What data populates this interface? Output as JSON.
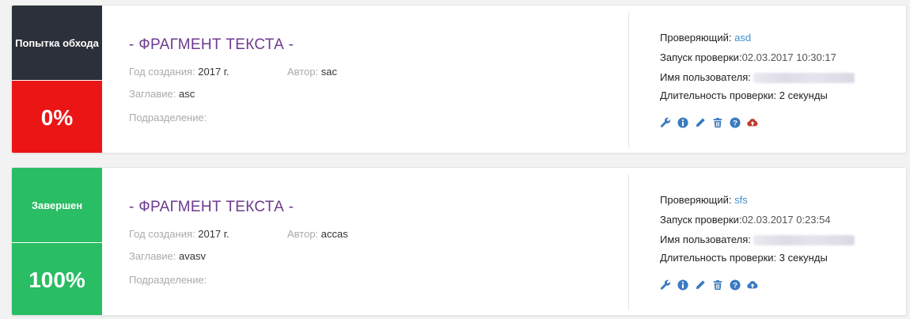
{
  "colors": {
    "dark": "#2b303a",
    "red": "#ec1515",
    "green": "#29bd64",
    "title": "#6d3a8e",
    "link": "#3d8fd1",
    "icon": "#3a7ac0",
    "cloud_red": "#c0392b"
  },
  "labels": {
    "year": "Год создания:",
    "author": "Автор:",
    "title": "Заглавие:",
    "division": "Подразделение:",
    "reviewer": "Проверяющий:",
    "started": "Запуск проверки:",
    "username": "Имя пользователя:",
    "duration": "Длительность проверки:"
  },
  "checks": [
    {
      "status": "Попытка обхода",
      "percent": "0%",
      "fragment_title": "- ФРАГМЕНТ ТЕКСТА -",
      "year": "2017 г.",
      "author": "sac",
      "doc_title": "asc",
      "division": "",
      "reviewer": "asd",
      "started": "02.03.2017 10:30:17",
      "duration": "2 секунды",
      "actions": [
        "wrench-icon",
        "info-icon",
        "pencil-icon",
        "trash-icon",
        "help-icon",
        "cloud-upload-icon"
      ]
    },
    {
      "status": "Завершен",
      "percent": "100%",
      "fragment_title": "- ФРАГМЕНТ ТЕКСТА -",
      "year": "2017 г.",
      "author": "accas",
      "doc_title": "avasv",
      "division": "",
      "reviewer": "sfs",
      "started": "02.03.2017 0:23:54",
      "duration": "3 секунды",
      "actions": [
        "wrench-icon",
        "info-icon",
        "pencil-icon",
        "trash-icon",
        "help-icon",
        "cloud-upload-icon"
      ]
    }
  ]
}
